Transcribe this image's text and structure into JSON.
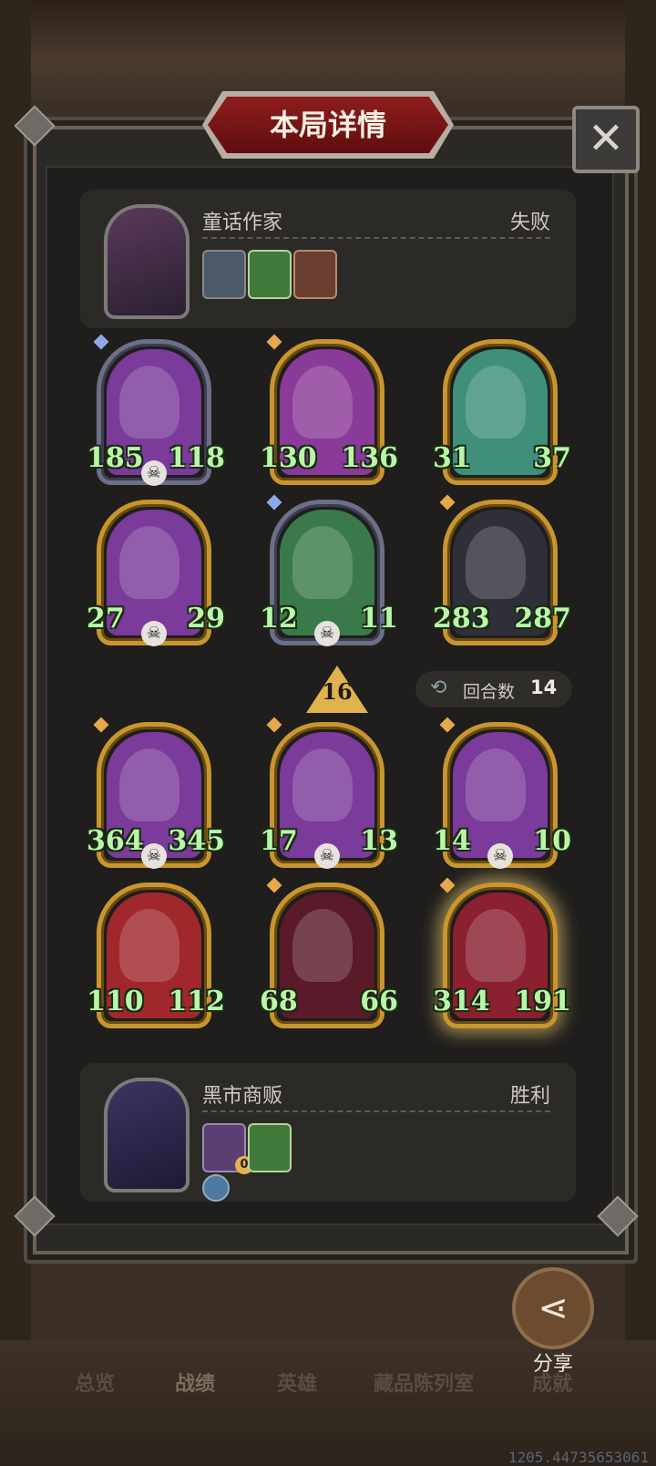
{
  "dialog": {
    "title": "本局详情",
    "close_icon": "close-icon"
  },
  "player_top": {
    "name": "童话作家",
    "result": "失败",
    "items": [
      "hero-mini-icon",
      "green-book-icon",
      "brown-book-icon"
    ]
  },
  "board": {
    "enemy_rows": [
      [
        {
          "atk": "185",
          "hp": "118",
          "frame": "silver",
          "gem": "blue",
          "skull": true,
          "color": "#7a3b9a"
        },
        {
          "atk": "130",
          "hp": "136",
          "frame": "gold",
          "gem": "gold",
          "skull": false,
          "color": "#8a3a98"
        },
        {
          "atk": "31",
          "hp": "37",
          "frame": "gold",
          "gem": "none",
          "skull": false,
          "color": "#3f8f7a"
        }
      ],
      [
        {
          "atk": "27",
          "hp": "29",
          "frame": "gold",
          "gem": "none",
          "skull": true,
          "color": "#7a3b9a"
        },
        {
          "atk": "12",
          "hp": "11",
          "frame": "silver",
          "gem": "blue",
          "skull": true,
          "color": "#3a7a4a"
        },
        {
          "atk": "283",
          "hp": "287",
          "frame": "gold",
          "gem": "gold",
          "skull": false,
          "color": "#2f2f3a"
        }
      ]
    ],
    "ally_rows": [
      [
        {
          "atk": "364",
          "hp": "345",
          "frame": "gold",
          "gem": "gold",
          "skull": true,
          "color": "#7a3b9a"
        },
        {
          "atk": "17",
          "hp": "13",
          "frame": "gold",
          "gem": "gold",
          "skull": true,
          "color": "#7a3b9a"
        },
        {
          "atk": "14",
          "hp": "10",
          "frame": "gold",
          "gem": "gold",
          "skull": true,
          "color": "#7a3b9a"
        }
      ],
      [
        {
          "atk": "110",
          "hp": "112",
          "frame": "gold",
          "gem": "none",
          "skull": false,
          "color": "#a0282c"
        },
        {
          "atk": "68",
          "hp": "66",
          "frame": "gold",
          "gem": "gold",
          "skull": false,
          "color": "#5a1a2a"
        },
        {
          "atk": "314",
          "hp": "191",
          "frame": "gold",
          "gem": "gold",
          "skull": false,
          "color": "#8a2030",
          "glow": true
        }
      ]
    ],
    "marker_value": "16",
    "turn_label": "回合数",
    "turn_value": "14"
  },
  "player_bottom": {
    "name": "黑市商贩",
    "result": "胜利",
    "items": [
      "door-icon",
      "green-book-icon",
      "sword-badge-icon"
    ],
    "door_count": "0"
  },
  "share": {
    "label": "分享"
  },
  "tabs": [
    "总览",
    "战绩",
    "英雄",
    "藏品陈列室",
    "成就"
  ],
  "active_tab": "战绩",
  "coords": "1205.44735653061"
}
